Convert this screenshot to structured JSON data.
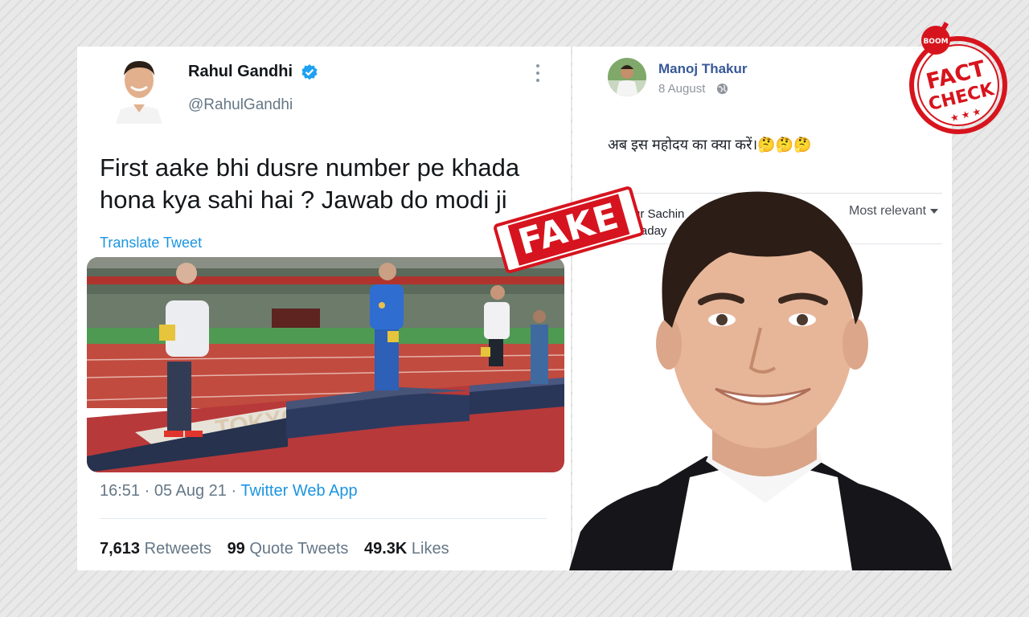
{
  "tweet": {
    "author_name": "Rahul Gandhi",
    "handle": "@RahulGandhi",
    "text": "First aake bhi dusre number pe khada hona kya sahi hai ? Jawab do modi ji",
    "translate_label": "Translate Tweet",
    "time": "16:51",
    "date": "05 Aug 21",
    "source": "Twitter Web App",
    "retweets_count": "7,613",
    "retweets_label": "Retweets",
    "quote_count": "99",
    "quote_label": "Quote Tweets",
    "likes_count": "49.3K",
    "likes_label": "Likes",
    "photo_banner_text": "TOKYO",
    "icons": {
      "verified": "verified-badge-icon",
      "more": "more-options-icon"
    }
  },
  "facebook": {
    "author_name": "Manoj Thakur",
    "date": "8 August",
    "post_text": "अब इस महोदय का क्या करें।🤔🤔🤔",
    "comment_preview_line1": "ur Sachin",
    "comment_preview_line2": "Yaday",
    "sort_label": "Most relevant",
    "icons": {
      "privacy": "globe-icon",
      "sort": "caret-down-icon"
    }
  },
  "overlays": {
    "fake_stamp": "FAKE",
    "fact_check_brand": "BOOM",
    "fact_check_line1": "FACT",
    "fact_check_line2": "CHECK"
  },
  "colors": {
    "twitter_blue": "#1b95e0",
    "facebook_blue": "#385898",
    "stamp_red": "#d6141f"
  }
}
